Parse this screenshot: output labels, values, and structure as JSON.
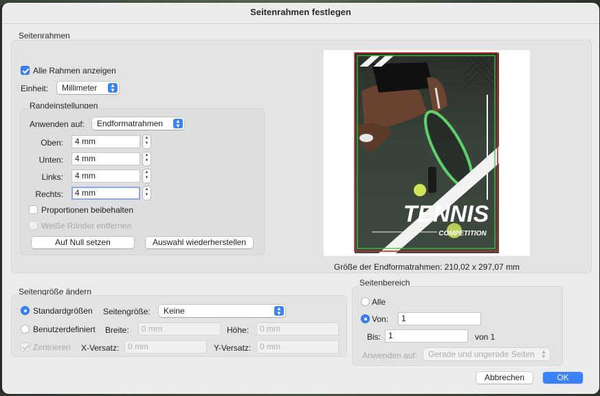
{
  "dialog": {
    "title": "Seitenrahmen festlegen"
  },
  "seitenrahmen": {
    "group_label": "Seitenrahmen",
    "show_all_label": "Alle Rahmen anzeigen",
    "show_all_checked": true,
    "unit_label": "Einheit:",
    "unit_value": "Millimeter",
    "margins": {
      "group_label": "Randeinstellungen",
      "apply_label": "Anwenden auf:",
      "apply_value": "Endformatrahmen",
      "top_label": "Oben:",
      "top_value": "4 mm",
      "bottom_label": "Unten:",
      "bottom_value": "4 mm",
      "left_label": "Links:",
      "left_value": "4 mm",
      "right_label": "Rechts:",
      "right_value": "4 mm",
      "proportions_label": "Proportionen beibehalten",
      "proportions_checked": false,
      "remove_white_label": "Weiße Ränder entfernen",
      "remove_white_checked": false,
      "reset_button": "Auf Null setzen",
      "restore_button": "Auswahl wiederherstellen"
    },
    "preview": {
      "poster_title": "TENNIS",
      "poster_subtitle": "COMPETITION",
      "size_text": "Größe der Endformatrahmen: 210,02 x 297,07 mm"
    }
  },
  "page_size": {
    "group_label": "Seitengröße ändern",
    "standard_label": "Standardgrößen",
    "standard_selected": true,
    "size_label": "Seitengröße:",
    "size_value": "Keine",
    "custom_label": "Benutzerdefiniert",
    "width_label": "Breite:",
    "width_value": "0 mm",
    "height_label": "Höhe:",
    "height_value": "0 mm",
    "center_label": "Zentrieren",
    "center_checked": true,
    "xoffset_label": "X-Versatz:",
    "xoffset_value": "0 mm",
    "yoffset_label": "Y-Versatz:",
    "yoffset_value": "0 mm"
  },
  "page_range": {
    "group_label": "Seitenbereich",
    "all_label": "Alle",
    "from_label": "Von:",
    "from_selected": true,
    "from_value": "1",
    "to_label": "Bis:",
    "to_value": "1",
    "of_text": "von 1",
    "apply_label": "Anwenden auf:",
    "apply_value": "Gerade und ungerade Seiten"
  },
  "buttons": {
    "cancel": "Abbrechen",
    "ok": "OK"
  },
  "colors": {
    "accent": "#3b82f6",
    "crop_red": "#c1272d",
    "trim_green": "#39c43a"
  }
}
